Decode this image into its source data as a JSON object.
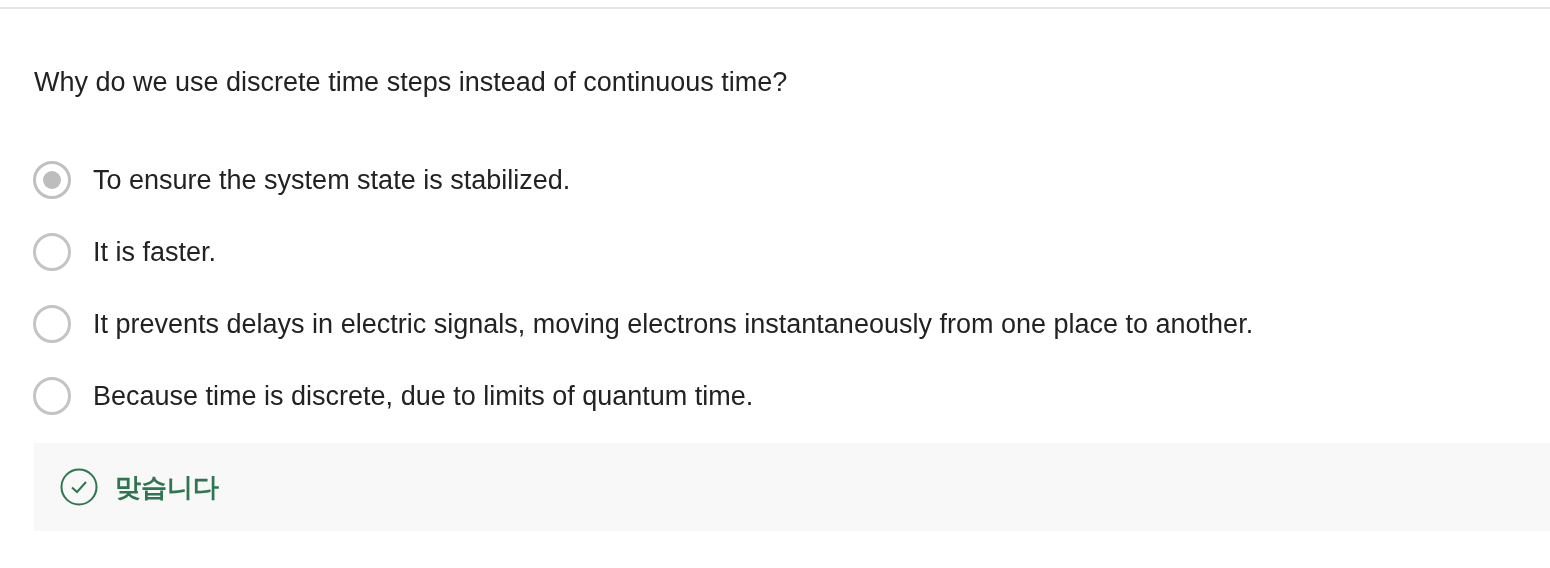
{
  "question": "Why do we use discrete time steps instead of continuous time?",
  "options": [
    {
      "label": "To ensure the system state is stabilized.",
      "selected": true
    },
    {
      "label": "It is faster.",
      "selected": false
    },
    {
      "label": "It prevents delays in electric signals, moving electrons instantaneously from one place to another.",
      "selected": false
    },
    {
      "label": "Because time is discrete, due to limits of quantum time.",
      "selected": false
    }
  ],
  "feedback": {
    "kind": "correct",
    "text": "맞습니다"
  }
}
